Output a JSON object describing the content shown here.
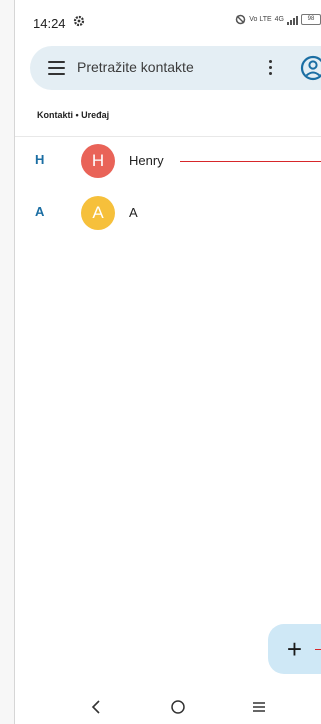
{
  "status_bar": {
    "time": "14:24",
    "icons": [
      "gear-icon",
      "mute-icon",
      "volte-icon",
      "signal-icon",
      "battery-icon"
    ],
    "network_text": "Vo LTE",
    "network_gen": "4G",
    "battery": "98"
  },
  "search": {
    "placeholder": "Pretražite kontakte",
    "menu_icon": "hamburger-icon",
    "more_icon": "more-vert-icon",
    "account_icon": "account-circle-icon"
  },
  "account_label": "Kontakti • Uređaj",
  "contacts": [
    {
      "section": "H",
      "initial": "H",
      "name": "Henry",
      "avatar_color": "#e96358"
    },
    {
      "section": "A",
      "initial": "A",
      "name": "A",
      "avatar_color": "#f6c03b"
    }
  ],
  "fab": {
    "label": "+",
    "icon": "add-icon"
  },
  "nav": {
    "back_icon": "back-icon",
    "home_icon": "home-icon",
    "recents_icon": "menu-icon"
  },
  "colors": {
    "accent": "#1b6ea3",
    "search_bg": "#e4eef4",
    "fab_bg": "#cfe8f6",
    "annotation_line": "#d7262a"
  }
}
